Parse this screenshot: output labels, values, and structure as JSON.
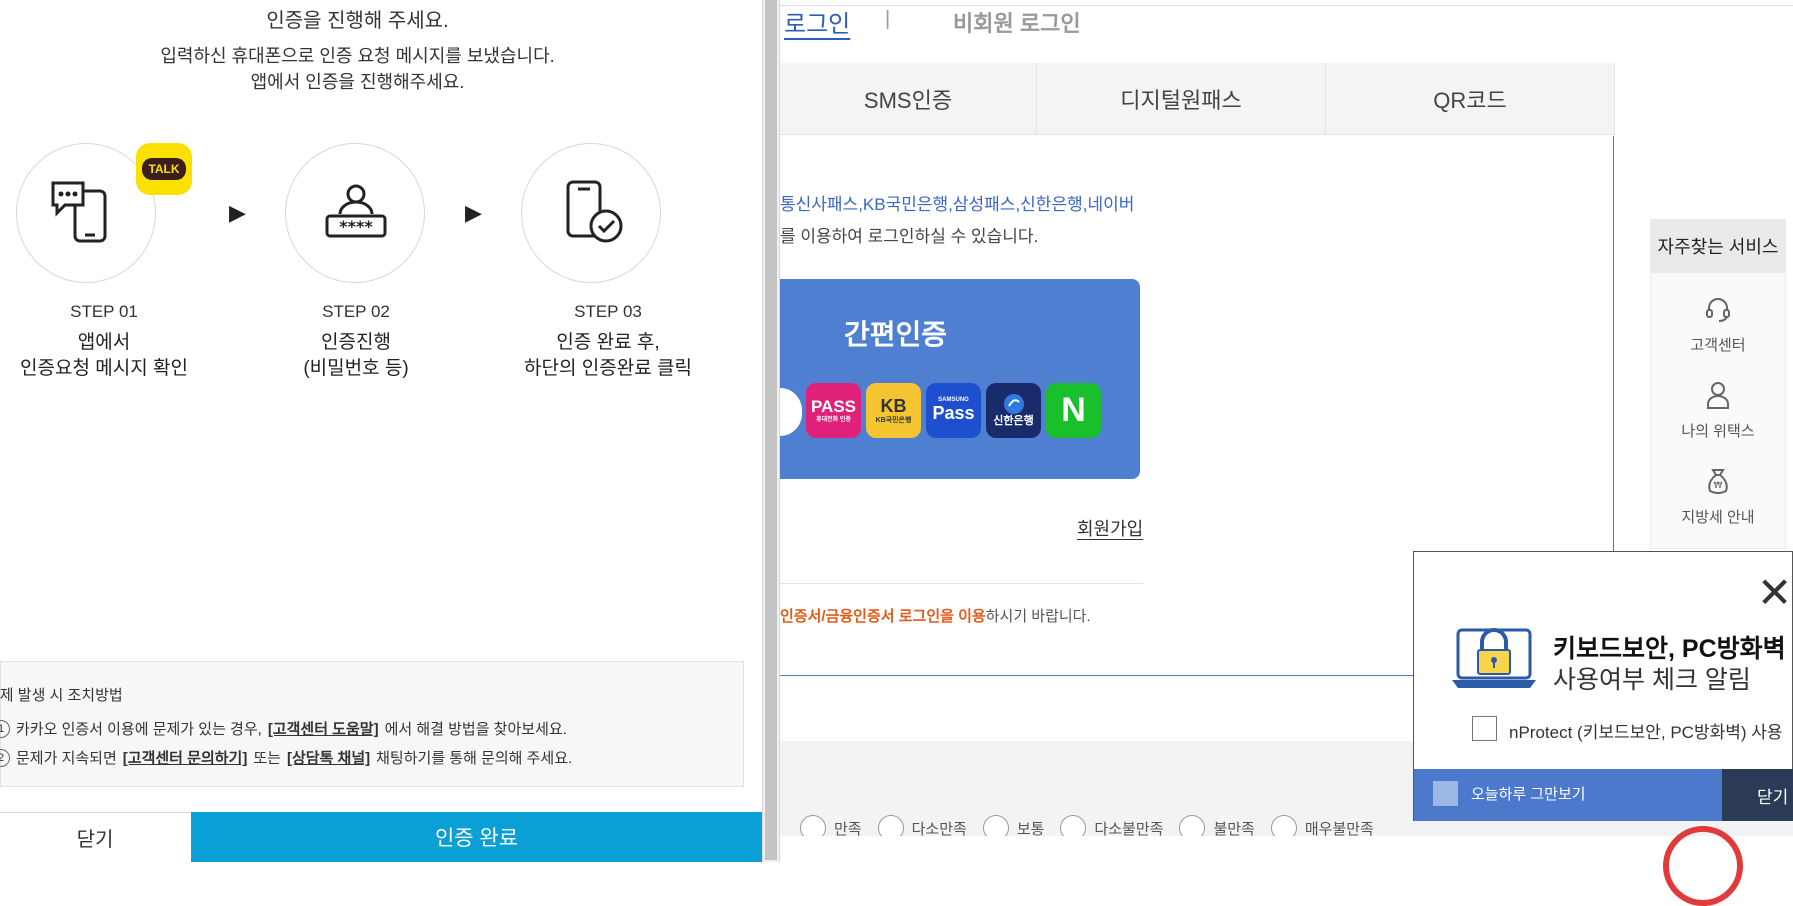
{
  "modal": {
    "heading": "인증을 진행해 주세요.",
    "sub_line1": "입력하신 휴대폰으로 인증 요청 메시지를 보냈습니다.",
    "sub_line2": "앱에서 인증을 진행해주세요.",
    "talk_badge": "TALK",
    "steps": [
      {
        "label": "STEP 01",
        "line1": "앱에서",
        "line2": "인증요청 메시지 확인"
      },
      {
        "label": "STEP 02",
        "line1": "인증진행",
        "line2": "(비밀번호 등)"
      },
      {
        "label": "STEP 03",
        "line1": "인증 완료 후,",
        "line2": "하단의 인증완료 클릭"
      }
    ],
    "help": {
      "title": "문제 발생 시 조치방법",
      "row1_num": "1",
      "row1_pre": "카카오 인증서 이용에 문제가 있는 경우,",
      "row1_link": "[고객센터 도움말]",
      "row1_post": "에서 해결 방법을 찾아보세요.",
      "row2_num": "2",
      "row2_pre": "문제가 지속되면",
      "row2_link1": "[고객센터 문의하기]",
      "row2_mid": "또는",
      "row2_link2": "[상담톡 채널]",
      "row2_post": "채팅하기를 통해 문의해 주세요."
    },
    "close_button": "닫기",
    "done_button": "인증 완료"
  },
  "page": {
    "login_tab": "로그인",
    "guest_tab": "비회원 로그인",
    "separator": "|",
    "auth_tabs": [
      "SMS인증",
      "디지털원패스",
      "QR코드"
    ],
    "desc_line1": "통신사패스,KB국민은행,삼성패스,신한은행,네이버",
    "desc_line2": "를 이용하여 로그인하실 수 있습니다.",
    "easy_auth_title": "간편인증",
    "apps": [
      {
        "name": "PASS",
        "sub": "휴대전화 인증",
        "color": "#e0217a"
      },
      {
        "name": "KB",
        "sub": "KB국민은행",
        "color": "#f5c531"
      },
      {
        "name": "Pass",
        "sub": "SAMSUNG",
        "color": "#1e4fcf"
      },
      {
        "name": "신한은행",
        "sub": "",
        "color": "#1a2b6b"
      },
      {
        "name": "N",
        "sub": "",
        "color": "#19c02c"
      }
    ],
    "signup_link": "회원가입",
    "notice_bold": "인증서/금융인증서 로그인을 이용",
    "notice_rest": "하시기 바랍니다.",
    "survey_options": [
      "만족",
      "다소만족",
      "보통",
      "다소불만족",
      "불만족",
      "매우불만족"
    ]
  },
  "quick_services": {
    "title": "자주찾는 서비스",
    "items": [
      {
        "label": "고객센터",
        "icon": "headset-icon"
      },
      {
        "label": "나의 위택스",
        "icon": "person-icon"
      },
      {
        "label": "지방세 안내",
        "icon": "money-bag-icon"
      }
    ]
  },
  "security_popup": {
    "title_line1": "키보드보안, PC방화벽",
    "title_line2": "사용여부 체크 알림",
    "check_label": "nProtect (키보드보안, PC방화벽) 사용",
    "dont_show_today": "오늘하루 그만보기",
    "close": "닫기"
  },
  "colors": {
    "accent_blue": "#4f7fd1",
    "done_button": "#0aa0d6",
    "talk_yellow": "#fce000",
    "notice_orange": "#e05a1a"
  }
}
